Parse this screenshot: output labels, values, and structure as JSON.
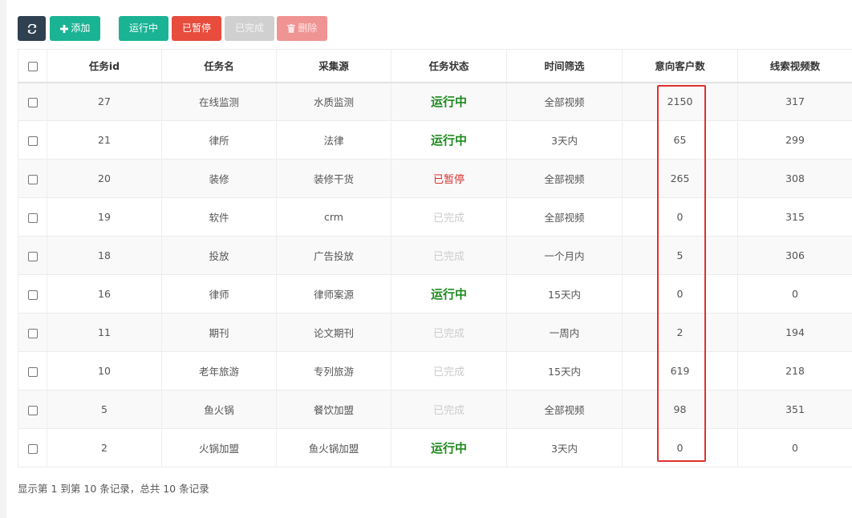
{
  "toolbar": {
    "add_label": "添加",
    "running_label": "运行中",
    "paused_label": "已暂停",
    "completed_label": "已完成",
    "delete_label": "删除"
  },
  "table": {
    "headers": [
      "任务id",
      "任务名",
      "采集源",
      "任务状态",
      "时间筛选",
      "意向客户数",
      "线索视频数"
    ],
    "rows": [
      {
        "id": "27",
        "name": "在线监测",
        "source": "水质监测",
        "status": "运行中",
        "status_type": "running",
        "time": "全部视频",
        "customers": "2150",
        "videos": "317"
      },
      {
        "id": "21",
        "name": "律所",
        "source": "法律",
        "status": "运行中",
        "status_type": "running",
        "time": "3天内",
        "customers": "65",
        "videos": "299"
      },
      {
        "id": "20",
        "name": "装修",
        "source": "装修干货",
        "status": "已暂停",
        "status_type": "paused",
        "time": "全部视频",
        "customers": "265",
        "videos": "308"
      },
      {
        "id": "19",
        "name": "软件",
        "source": "crm",
        "status": "已完成",
        "status_type": "done",
        "time": "全部视频",
        "customers": "0",
        "videos": "315"
      },
      {
        "id": "18",
        "name": "投放",
        "source": "广告投放",
        "status": "已完成",
        "status_type": "done",
        "time": "一个月内",
        "customers": "5",
        "videos": "306"
      },
      {
        "id": "16",
        "name": "律师",
        "source": "律师案源",
        "status": "运行中",
        "status_type": "running",
        "time": "15天内",
        "customers": "0",
        "videos": "0"
      },
      {
        "id": "11",
        "name": "期刊",
        "source": "论文期刊",
        "status": "已完成",
        "status_type": "done",
        "time": "一周内",
        "customers": "2",
        "videos": "194"
      },
      {
        "id": "10",
        "name": "老年旅游",
        "source": "专列旅游",
        "status": "已完成",
        "status_type": "done",
        "time": "15天内",
        "customers": "619",
        "videos": "218"
      },
      {
        "id": "5",
        "name": "鱼火锅",
        "source": "餐饮加盟",
        "status": "已完成",
        "status_type": "done",
        "time": "全部视频",
        "customers": "98",
        "videos": "351"
      },
      {
        "id": "2",
        "name": "火锅加盟",
        "source": "鱼火锅加盟",
        "status": "运行中",
        "status_type": "running",
        "time": "3天内",
        "customers": "0",
        "videos": "0"
      }
    ]
  },
  "footer": {
    "summary": "显示第 1 到第 10 条记录，总共 10 条记录"
  },
  "colors": {
    "dark": "#2f4050",
    "teal": "#1ab394",
    "red": "#e74c3c",
    "running": "#1e8a1e",
    "paused": "#d9302c",
    "highlight": "#e0312f"
  },
  "icons": {
    "refresh": "refresh-icon",
    "add": "plus-icon",
    "delete": "trash-icon"
  }
}
